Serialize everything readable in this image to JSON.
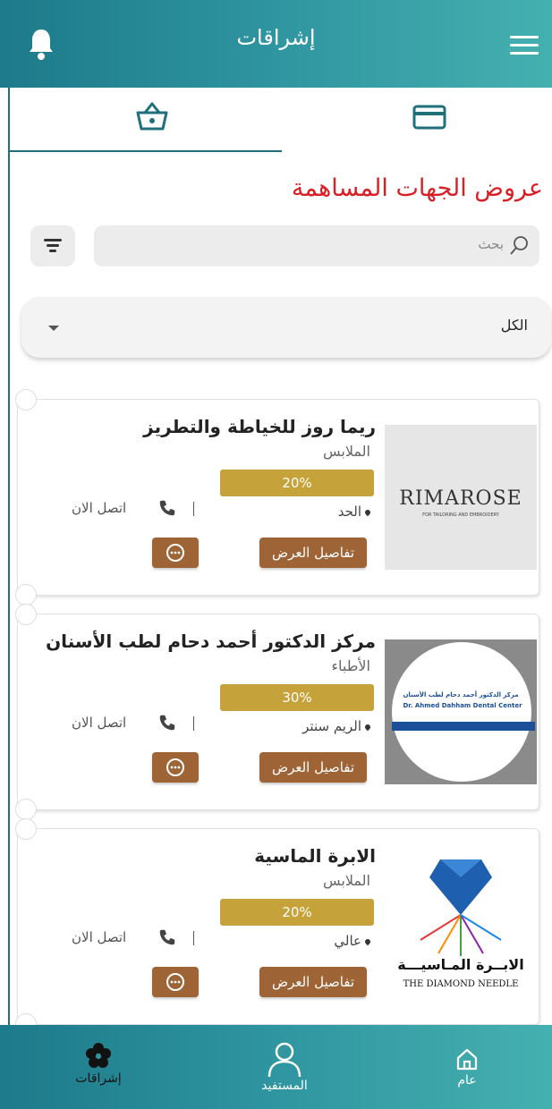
{
  "header": {
    "title": "إشراقات"
  },
  "section_title": "عروض الجهات المساهمة",
  "search": {
    "placeholder": "بحث"
  },
  "dropdown": {
    "selected": "الكل"
  },
  "offers": [
    {
      "name": "ريما روز للخياطة والتطريز",
      "category": "الملابس",
      "discount": "20%",
      "location": "الحد",
      "contact": "اتصل الان",
      "details": "تفاصيل العرض",
      "logo_text": "RIMAROSE",
      "logo_sub": "FOR TAILORING AND EMBROIDERY"
    },
    {
      "name": "مركز الدكتور أحمد دحام لطب الأسنان",
      "category": "الأطباء",
      "discount": "30%",
      "location": "الريم سنتر",
      "contact": "اتصل الان",
      "details": "تفاصيل العرض",
      "logo_text": "مركز الدكتور أحمد دحام لطب الأسنان",
      "logo_sub": "Dr. Ahmed Dahham Dental Center"
    },
    {
      "name": "الابرة الماسية",
      "category": "الملابس",
      "discount": "20%",
      "location": "عالي",
      "contact": "اتصل الان",
      "details": "تفاصيل العرض",
      "logo_text": "الابــرة المـاسيـــة",
      "logo_sub": "THE DIAMOND NEEDLE"
    }
  ],
  "bottom_nav": [
    {
      "label": "إشراقات",
      "icon": "flower-icon"
    },
    {
      "label": "المستفيد",
      "icon": "user-icon"
    },
    {
      "label": "عام",
      "icon": "home-icon"
    }
  ],
  "colors": {
    "header": "#2f95a0",
    "title_red": "#d81f26",
    "discount_gold": "#c6a23a",
    "button_brown": "#9e6436"
  }
}
